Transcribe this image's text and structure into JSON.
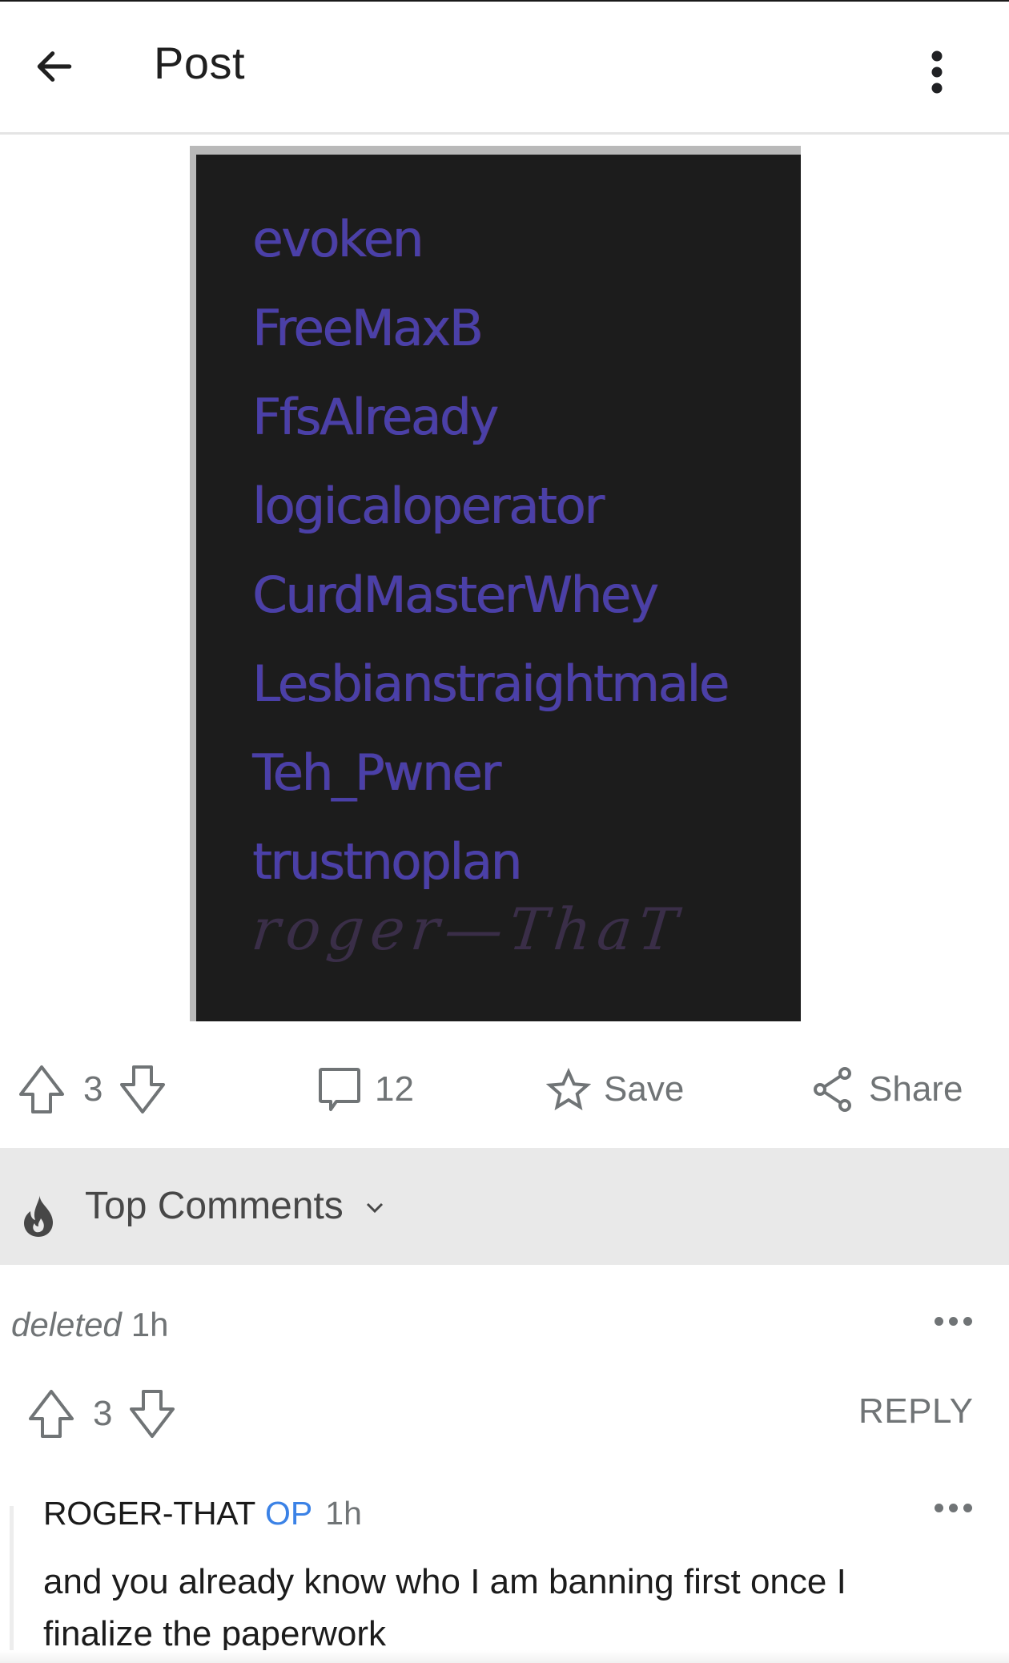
{
  "header": {
    "title": "Post",
    "back_icon": "arrow-left-icon",
    "more_icon": "more-vertical-icon"
  },
  "post": {
    "image": {
      "names": [
        "evoken",
        "FreeMaxB",
        "FfsAlready",
        "logicaloperator",
        "CurdMasterWhey",
        "Lesbianstraightmale",
        "Teh_Pwner",
        "trustnoplan"
      ],
      "signature": "roger—ThaT"
    },
    "actions": {
      "score": "3",
      "comments_count": "12",
      "save_label": "Save",
      "share_label": "Share",
      "upvote_icon": "upvote-arrow-icon",
      "downvote_icon": "downvote-arrow-icon",
      "comment_icon": "comment-bubble-icon",
      "save_icon": "star-icon",
      "share_icon": "share-icon"
    }
  },
  "sort": {
    "label": "Top Comments",
    "icon": "flame-icon",
    "caret_icon": "chevron-down-icon"
  },
  "comments": [
    {
      "author": "deleted",
      "time": "1h",
      "score": "3",
      "reply_label": "REPLY"
    },
    {
      "author": "ROGER-THAT",
      "badge": "OP",
      "time": "1h",
      "body": "and you already know who I am banning first once I finalize the paperwork"
    }
  ],
  "colors": {
    "op_badge": "#3b82e6",
    "meta_gray": "#707476",
    "sort_band": "#e9e9e9",
    "image_text": "#4a40a8"
  }
}
